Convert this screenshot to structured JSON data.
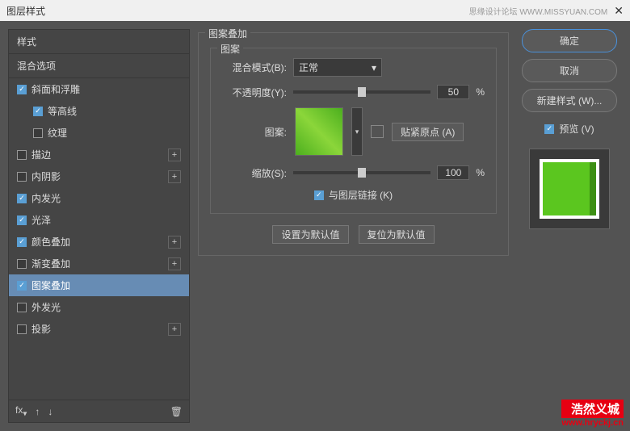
{
  "title": "图层样式",
  "watermark": "思缘设计论坛  WWW.MISSYUAN.COM",
  "sidebar": {
    "header": "样式",
    "blend": "混合选项",
    "items": [
      {
        "label": "斜面和浮雕",
        "checked": true,
        "hasPlus": false,
        "indent": false
      },
      {
        "label": "等高线",
        "checked": true,
        "hasPlus": false,
        "indent": true
      },
      {
        "label": "纹理",
        "checked": false,
        "hasPlus": false,
        "indent": true
      },
      {
        "label": "描边",
        "checked": false,
        "hasPlus": true,
        "indent": false
      },
      {
        "label": "内阴影",
        "checked": false,
        "hasPlus": true,
        "indent": false
      },
      {
        "label": "内发光",
        "checked": true,
        "hasPlus": false,
        "indent": false
      },
      {
        "label": "光泽",
        "checked": true,
        "hasPlus": false,
        "indent": false
      },
      {
        "label": "颜色叠加",
        "checked": true,
        "hasPlus": true,
        "indent": false
      },
      {
        "label": "渐变叠加",
        "checked": false,
        "hasPlus": true,
        "indent": false
      },
      {
        "label": "图案叠加",
        "checked": true,
        "hasPlus": false,
        "indent": false,
        "selected": true
      },
      {
        "label": "外发光",
        "checked": false,
        "hasPlus": false,
        "indent": false
      },
      {
        "label": "投影",
        "checked": false,
        "hasPlus": true,
        "indent": false
      }
    ],
    "footer_fx": "fx"
  },
  "panel": {
    "title": "图案叠加",
    "group": "图案",
    "blend_label": "混合模式(B):",
    "blend_value": "正常",
    "opacity_label": "不透明度(Y):",
    "opacity_value": "50",
    "pct": "%",
    "pattern_label": "图案:",
    "snap_btn": "贴紧原点 (A)",
    "scale_label": "缩放(S):",
    "scale_value": "100",
    "link_label": "与图层链接 (K)",
    "default_btn": "设置为默认值",
    "reset_btn": "复位为默认值"
  },
  "right": {
    "ok": "确定",
    "cancel": "取消",
    "newstyle": "新建样式 (W)...",
    "preview": "预览 (V)"
  },
  "logo": {
    "text": "浩然义城",
    "url": "www.hryckj.cn"
  }
}
